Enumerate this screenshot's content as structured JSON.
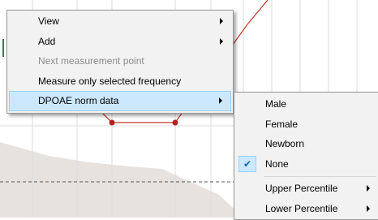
{
  "main_menu": {
    "items": [
      {
        "label": "View",
        "has_submenu": true,
        "enabled": true
      },
      {
        "label": "Add",
        "has_submenu": true,
        "enabled": true
      },
      {
        "label": "Next measurement point",
        "has_submenu": false,
        "enabled": false
      },
      {
        "label": "Measure only selected  frequency",
        "has_submenu": false,
        "enabled": true
      },
      {
        "label": "DPOAE norm data",
        "has_submenu": true,
        "enabled": true,
        "highlighted": true
      }
    ]
  },
  "submenu": {
    "items": [
      {
        "label": "Male",
        "checked": false
      },
      {
        "label": "Female",
        "checked": false
      },
      {
        "label": "Newborn",
        "checked": false
      },
      {
        "label": "None",
        "checked": true
      },
      {
        "label": "Upper Percentile",
        "has_submenu": true
      },
      {
        "label": "Lower Percentile",
        "has_submenu": true
      }
    ]
  },
  "colors": {
    "menu_bg": "#f2f2f2",
    "highlight_bg": "#cce8ff",
    "highlight_border": "#99d1ff",
    "measurement_line": "#c0392b",
    "norm_area": "#e8e2df"
  }
}
